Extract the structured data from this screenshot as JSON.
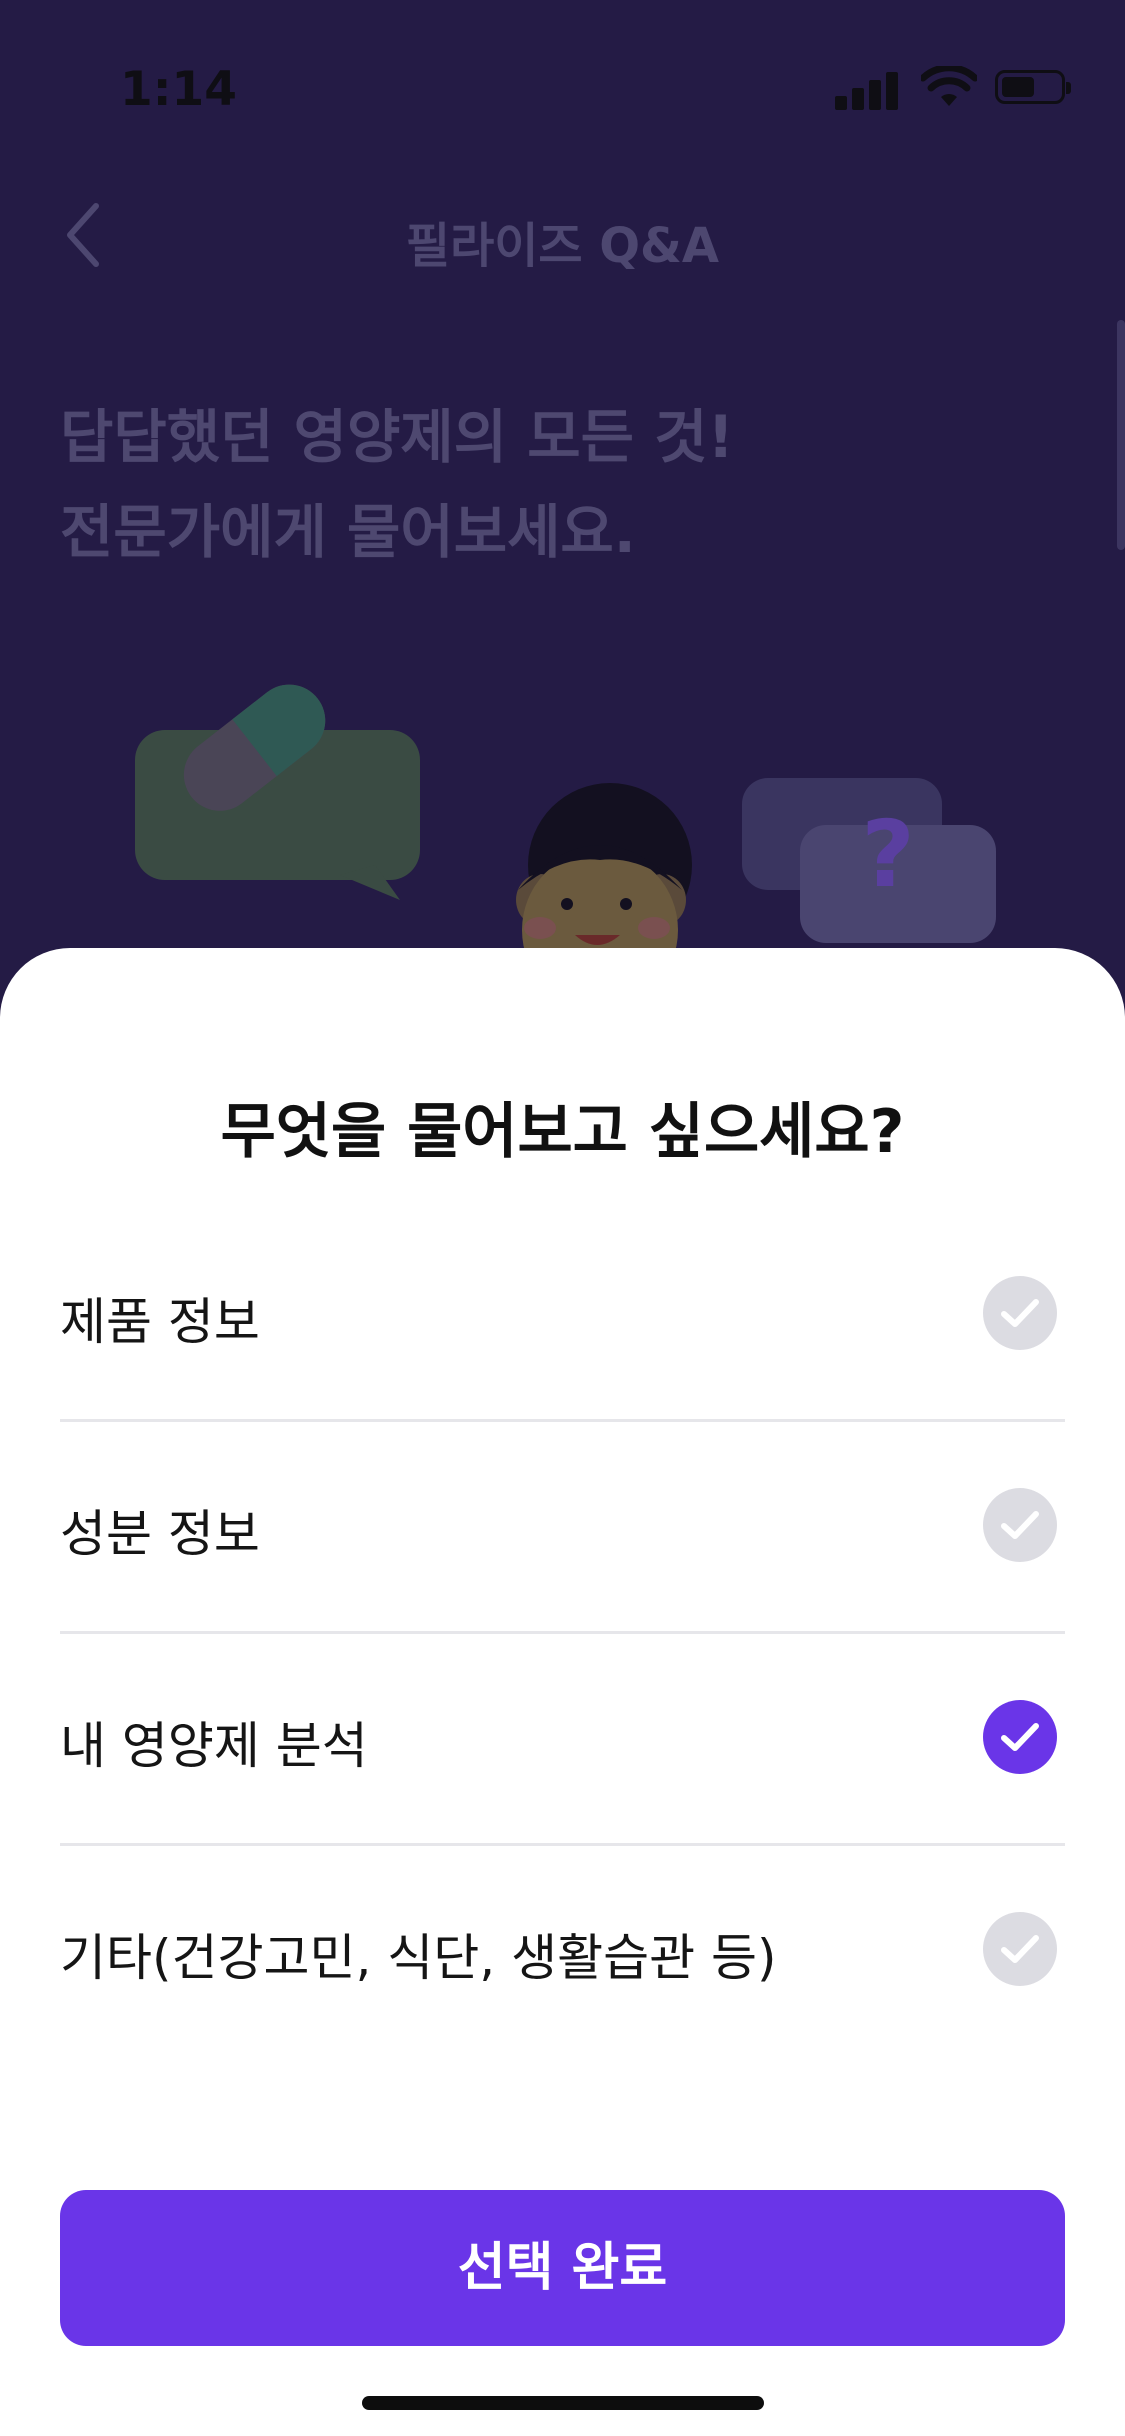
{
  "status_bar": {
    "time": "1:14",
    "icons": [
      "signal-icon",
      "wifi-icon",
      "battery-icon"
    ]
  },
  "nav": {
    "title": "필라이즈 Q&A",
    "back_icon": "chevron-left-icon"
  },
  "hero": {
    "line1": "답답했던 영양제의 모든 것!",
    "line2": "전문가에게 물어보세요."
  },
  "sheet": {
    "title": "무엇을 물어보고 싶으세요?",
    "options": [
      {
        "label": "제품 정보",
        "selected": false
      },
      {
        "label": "성분 정보",
        "selected": false
      },
      {
        "label": "내 영양제 분석",
        "selected": true
      },
      {
        "label": "기타(건강고민, 식단, 생활습관 등)",
        "selected": false
      }
    ],
    "confirm_label": "선택 완료"
  },
  "colors": {
    "accent": "#6a35e8",
    "unchecked": "#dcdce2",
    "backdrop": "#241b45"
  }
}
